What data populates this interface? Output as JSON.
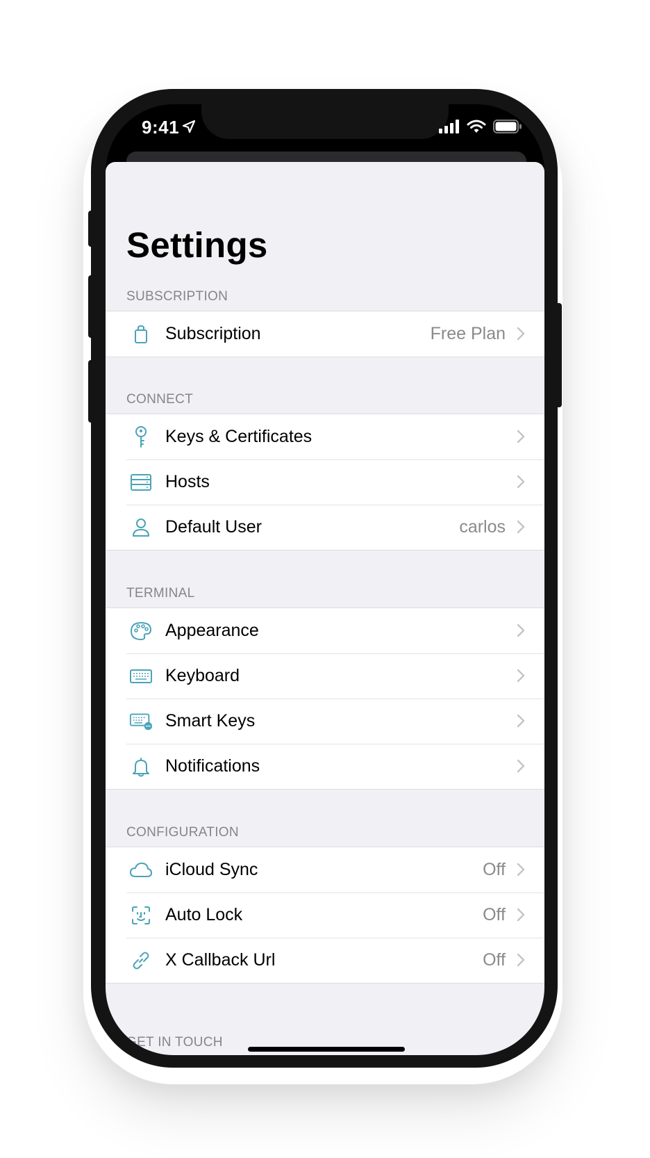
{
  "status_bar": {
    "time": "9:41"
  },
  "page": {
    "title": "Settings"
  },
  "sections": [
    {
      "header": "SUBSCRIPTION",
      "rows": [
        {
          "icon": "shopping-bag-icon",
          "label": "Subscription",
          "value": "Free Plan"
        }
      ]
    },
    {
      "header": "CONNECT",
      "rows": [
        {
          "icon": "key-icon",
          "label": "Keys & Certificates",
          "value": ""
        },
        {
          "icon": "server-icon",
          "label": "Hosts",
          "value": ""
        },
        {
          "icon": "person-icon",
          "label": "Default User",
          "value": "carlos"
        }
      ]
    },
    {
      "header": "TERMINAL",
      "rows": [
        {
          "icon": "palette-icon",
          "label": "Appearance",
          "value": ""
        },
        {
          "icon": "keyboard-icon",
          "label": "Keyboard",
          "value": ""
        },
        {
          "icon": "smart-keys-icon",
          "label": "Smart Keys",
          "value": ""
        },
        {
          "icon": "bell-icon",
          "label": "Notifications",
          "value": ""
        }
      ]
    },
    {
      "header": "CONFIGURATION",
      "rows": [
        {
          "icon": "cloud-icon",
          "label": "iCloud Sync",
          "value": "Off"
        },
        {
          "icon": "face-id-icon",
          "label": "Auto Lock",
          "value": "Off"
        },
        {
          "icon": "link-icon",
          "label": "X Callback Url",
          "value": "Off"
        }
      ]
    },
    {
      "header": "GET IN TOUCH",
      "rows": []
    }
  ],
  "colors": {
    "accent": "#4aa3b8",
    "group_background": "#f0f0f5",
    "secondary_text": "#8a8a8e"
  }
}
